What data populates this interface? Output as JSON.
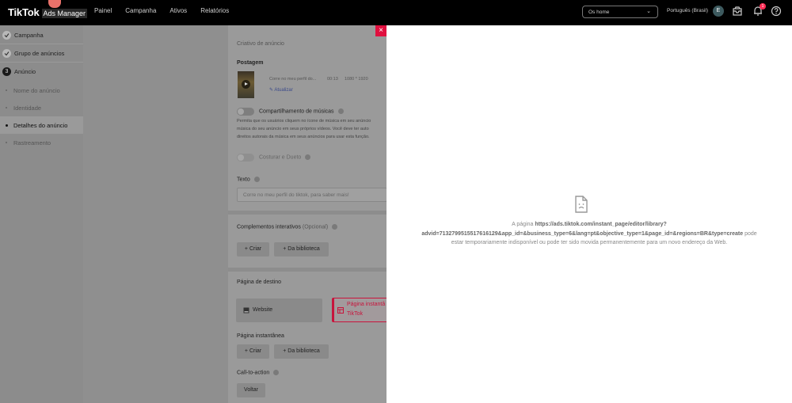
{
  "app": {
    "logo_text": "TikTok",
    "logo_sub": "Ads Manager"
  },
  "nav": [
    "Painel",
    "Campanha",
    "Ativos",
    "Relatórios"
  ],
  "header": {
    "account_select": "Os home",
    "language": "Português (Brasil)",
    "avatar_initial": "E",
    "notification_count": "1"
  },
  "sidebar": {
    "campaign": "Campanha",
    "ad_group": "Grupo de anúncios",
    "ad_step_number": "3",
    "ad": "Anúncio",
    "sub_items": [
      "Nome do anúncio",
      "Identidade",
      "Detalhes do anúncio",
      "Rastreamento"
    ],
    "active_sub_item": "Detalhes do anúncio"
  },
  "form": {
    "creative_heading": "Criativo de anúncio",
    "post_label": "Postagem",
    "post": {
      "caption": "Corre no meu perfil do...",
      "duration": "00:13",
      "resolution": "1080 * 1920",
      "update_link": "Atualizar"
    },
    "music_sharing_label": "Compartilhamento de músicas",
    "music_sharing_desc": [
      "Permita que os usuários cliquem no ícone de música em seu anúncio",
      "música do seu anúncio em seus próprios vídeos. Você deve ter auto",
      "direitos autorais da música em seus anúncios para usar esta função."
    ],
    "stitch_duet_label": "Costurar e Dueto",
    "text_label": "Texto",
    "text_value": "Corre no meu perfil do tiktok, para saber mais!",
    "interactive_label": "Complementos interativos",
    "interactive_optional": "(Opcional)",
    "create_button": "Criar",
    "library_button": "Da biblioteca",
    "destination_label": "Página de destino",
    "destination_website": "Website",
    "destination_instant_line1": "Página instantâ",
    "destination_instant_line2": "TikTok",
    "instant_page_label": "Página instantânea",
    "cta_label": "Call-to-action",
    "cta_value": "Voltar"
  },
  "overlay": {
    "error_prefix": "A página",
    "error_url": "https://ads.tiktok.com/instant_page/editor/library?",
    "error_url_line2": "advid=7132799515517616129&app_id=&business_type=6&lang=pt&objective_type=1&page_id=&regions=BR&type=create",
    "error_suffix_line2": "pode",
    "error_line3": "estar temporariamente indisponível ou pode ter sido movida permanentemente para um novo endereço da Web."
  }
}
